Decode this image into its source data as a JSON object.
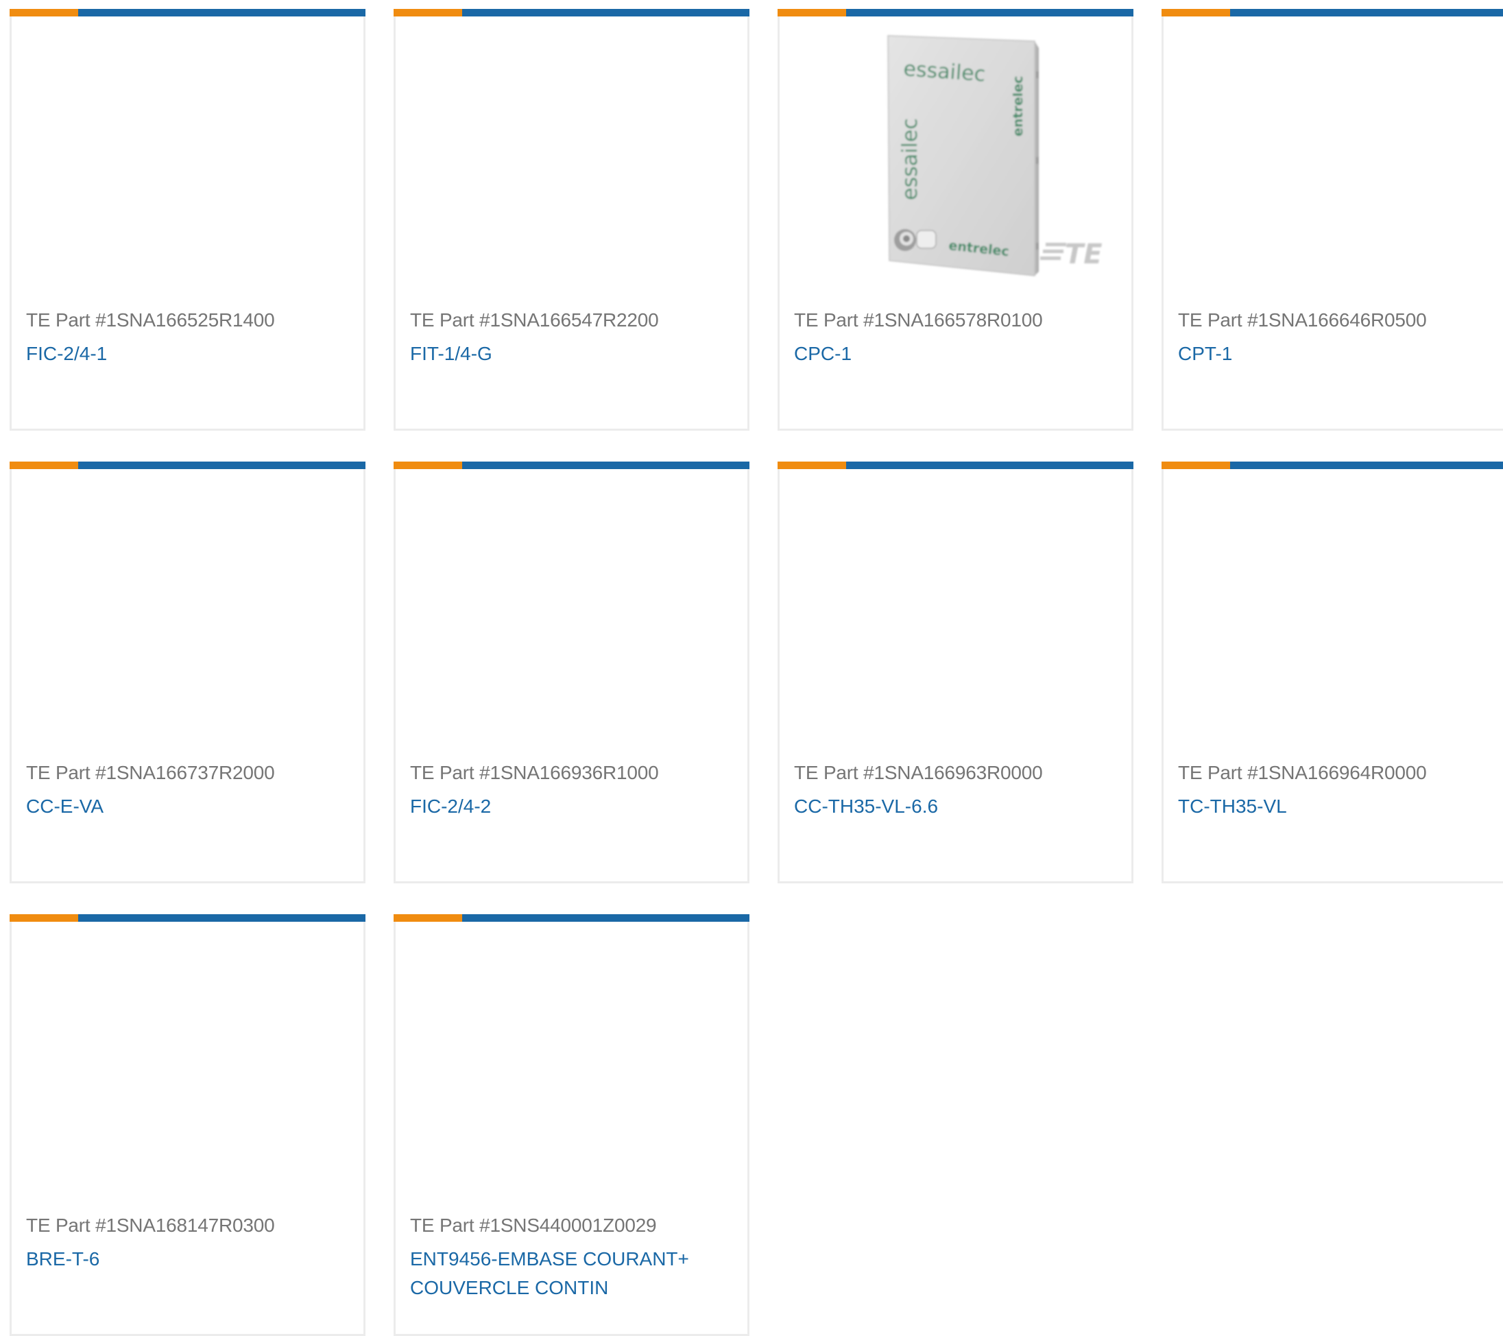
{
  "colors": {
    "accent_orange": "#f08c10",
    "brand_blue": "#1a68a6",
    "part_gray": "#757575",
    "card_border": "#ececec",
    "essailec_green": "#3c8a66"
  },
  "products": [
    {
      "part": "TE Part #1SNA166525R1400",
      "name": "FIC-2/4-1",
      "has_image": false
    },
    {
      "part": "TE Part #1SNA166547R2200",
      "name": "FIT-1/4-G",
      "has_image": false
    },
    {
      "part": "TE Part #1SNA166578R0100",
      "name": "CPC-1",
      "has_image": true,
      "image": {
        "brand_top": "essailec",
        "brand_side": "essailec",
        "maker_side": "entrelec",
        "maker_bottom": "entrelec",
        "watermark": "TE"
      }
    },
    {
      "part": "TE Part #1SNA166646R0500",
      "name": "CPT-1",
      "has_image": false
    },
    {
      "part": "TE Part #1SNA166737R2000",
      "name": "CC-E-VA",
      "has_image": false
    },
    {
      "part": "TE Part #1SNA166936R1000",
      "name": "FIC-2/4-2",
      "has_image": false
    },
    {
      "part": "TE Part #1SNA166963R0000",
      "name": "CC-TH35-VL-6.6",
      "has_image": false
    },
    {
      "part": "TE Part #1SNA166964R0000",
      "name": "TC-TH35-VL",
      "has_image": false
    },
    {
      "part": "TE Part #1SNA168147R0300",
      "name": "BRE-T-6",
      "has_image": false
    },
    {
      "part": "TE Part #1SNS440001Z0029",
      "name": "ENT9456-EMBASE COURANT+ COUVERCLE CONTIN",
      "has_image": false
    }
  ]
}
